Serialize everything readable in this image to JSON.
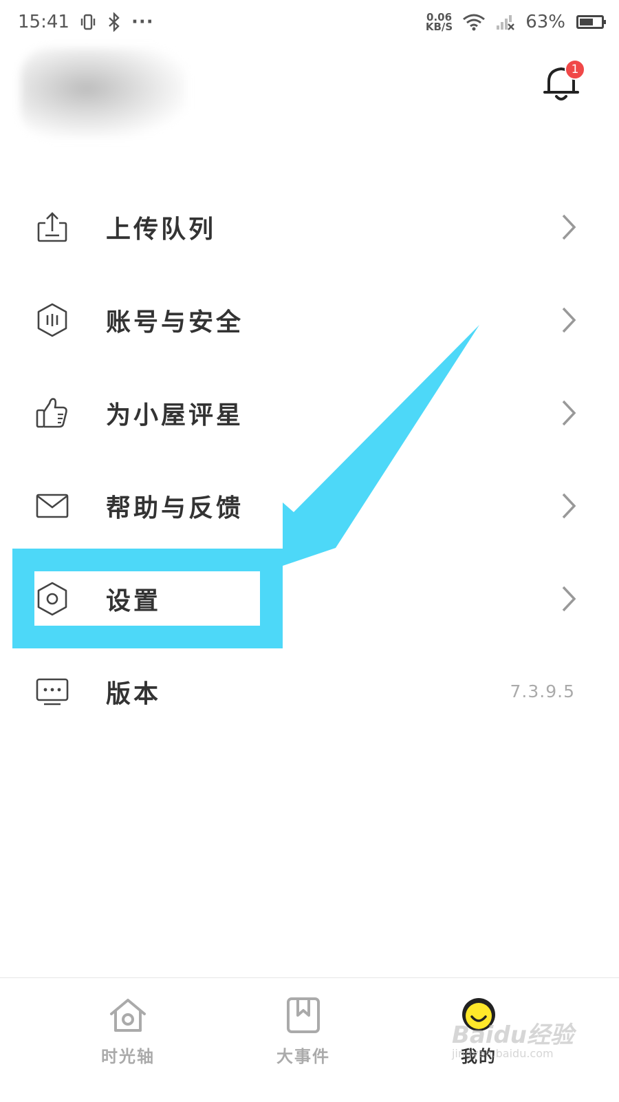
{
  "status_bar": {
    "time": "15:41",
    "vibrate_icon": "vibrate-icon",
    "bluetooth_icon": "bluetooth-icon",
    "more": "···",
    "net_speed_value": "0.06",
    "net_speed_unit": "KB/S",
    "battery_percent": "63%",
    "battery_level": 0.63
  },
  "header": {
    "notification_count": "1"
  },
  "menu": {
    "items": [
      {
        "label": "上传队列",
        "icon": "upload-icon"
      },
      {
        "label": "账号与安全",
        "icon": "shield-icon"
      },
      {
        "label": "为小屋评星",
        "icon": "thumbs-up-icon"
      },
      {
        "label": "帮助与反馈",
        "icon": "mail-icon"
      },
      {
        "label": "设置",
        "icon": "settings-icon"
      },
      {
        "label": "版本",
        "icon": "monitor-icon",
        "value": "7.3.9.5"
      }
    ]
  },
  "bottom_nav": {
    "tabs": [
      {
        "label": "时光轴",
        "icon": "home-icon"
      },
      {
        "label": "大事件",
        "icon": "bookmark-icon"
      },
      {
        "label": "我的",
        "icon": "smiley-avatar-icon",
        "active": true
      }
    ]
  },
  "colors": {
    "highlight": "#4dd8f8",
    "badge": "#f04848",
    "avatar": "#ffe82a"
  },
  "watermark": {
    "brand": "Baidu经验",
    "url": "jingyan.baidu.com"
  }
}
